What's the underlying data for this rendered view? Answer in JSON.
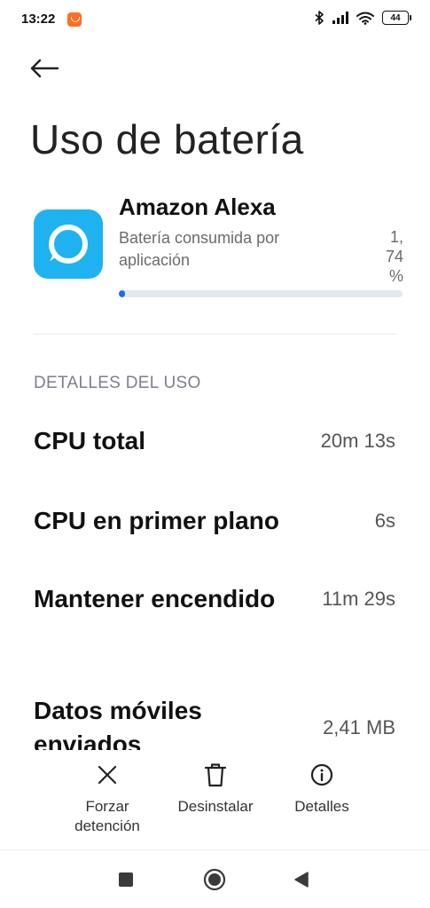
{
  "status_bar": {
    "time": "13:22",
    "battery_level": "44",
    "icons": [
      "orange-app-icon",
      "bluetooth-icon",
      "signal-icon",
      "wifi-icon",
      "battery-icon"
    ]
  },
  "header": {
    "back_icon": "arrow-left-icon",
    "title": "Uso de batería"
  },
  "app": {
    "name": "Amazon Alexa",
    "icon": "alexa-app-icon",
    "usage_label": "Batería consumida por aplicación",
    "usage_value_line1": "1,",
    "usage_value_line2": "74",
    "usage_value_line3": "%",
    "usage_fraction": 0.0174,
    "accent_color": "#1f6ed4",
    "icon_color": "#1fb2f0"
  },
  "details": {
    "section_title": "DETALLES DEL USO",
    "rows": [
      {
        "label": "CPU total",
        "value": "20m 13s"
      },
      {
        "label": "CPU en primer plano",
        "value": "6s"
      },
      {
        "label": "Mantener encendido",
        "value": "11m 29s"
      },
      {
        "label": "Datos móviles enviados",
        "value": "2,41 MB"
      }
    ]
  },
  "actions": [
    {
      "label_line1": "Forzar",
      "label_line2": "detención",
      "icon": "close-icon"
    },
    {
      "label_line1": "Desinstalar",
      "label_line2": "",
      "icon": "trash-icon"
    },
    {
      "label_line1": "Detalles",
      "label_line2": "",
      "icon": "info-icon"
    }
  ],
  "navbar": {
    "icons": [
      "recents-square-icon",
      "home-circle-icon",
      "back-triangle-icon"
    ]
  }
}
